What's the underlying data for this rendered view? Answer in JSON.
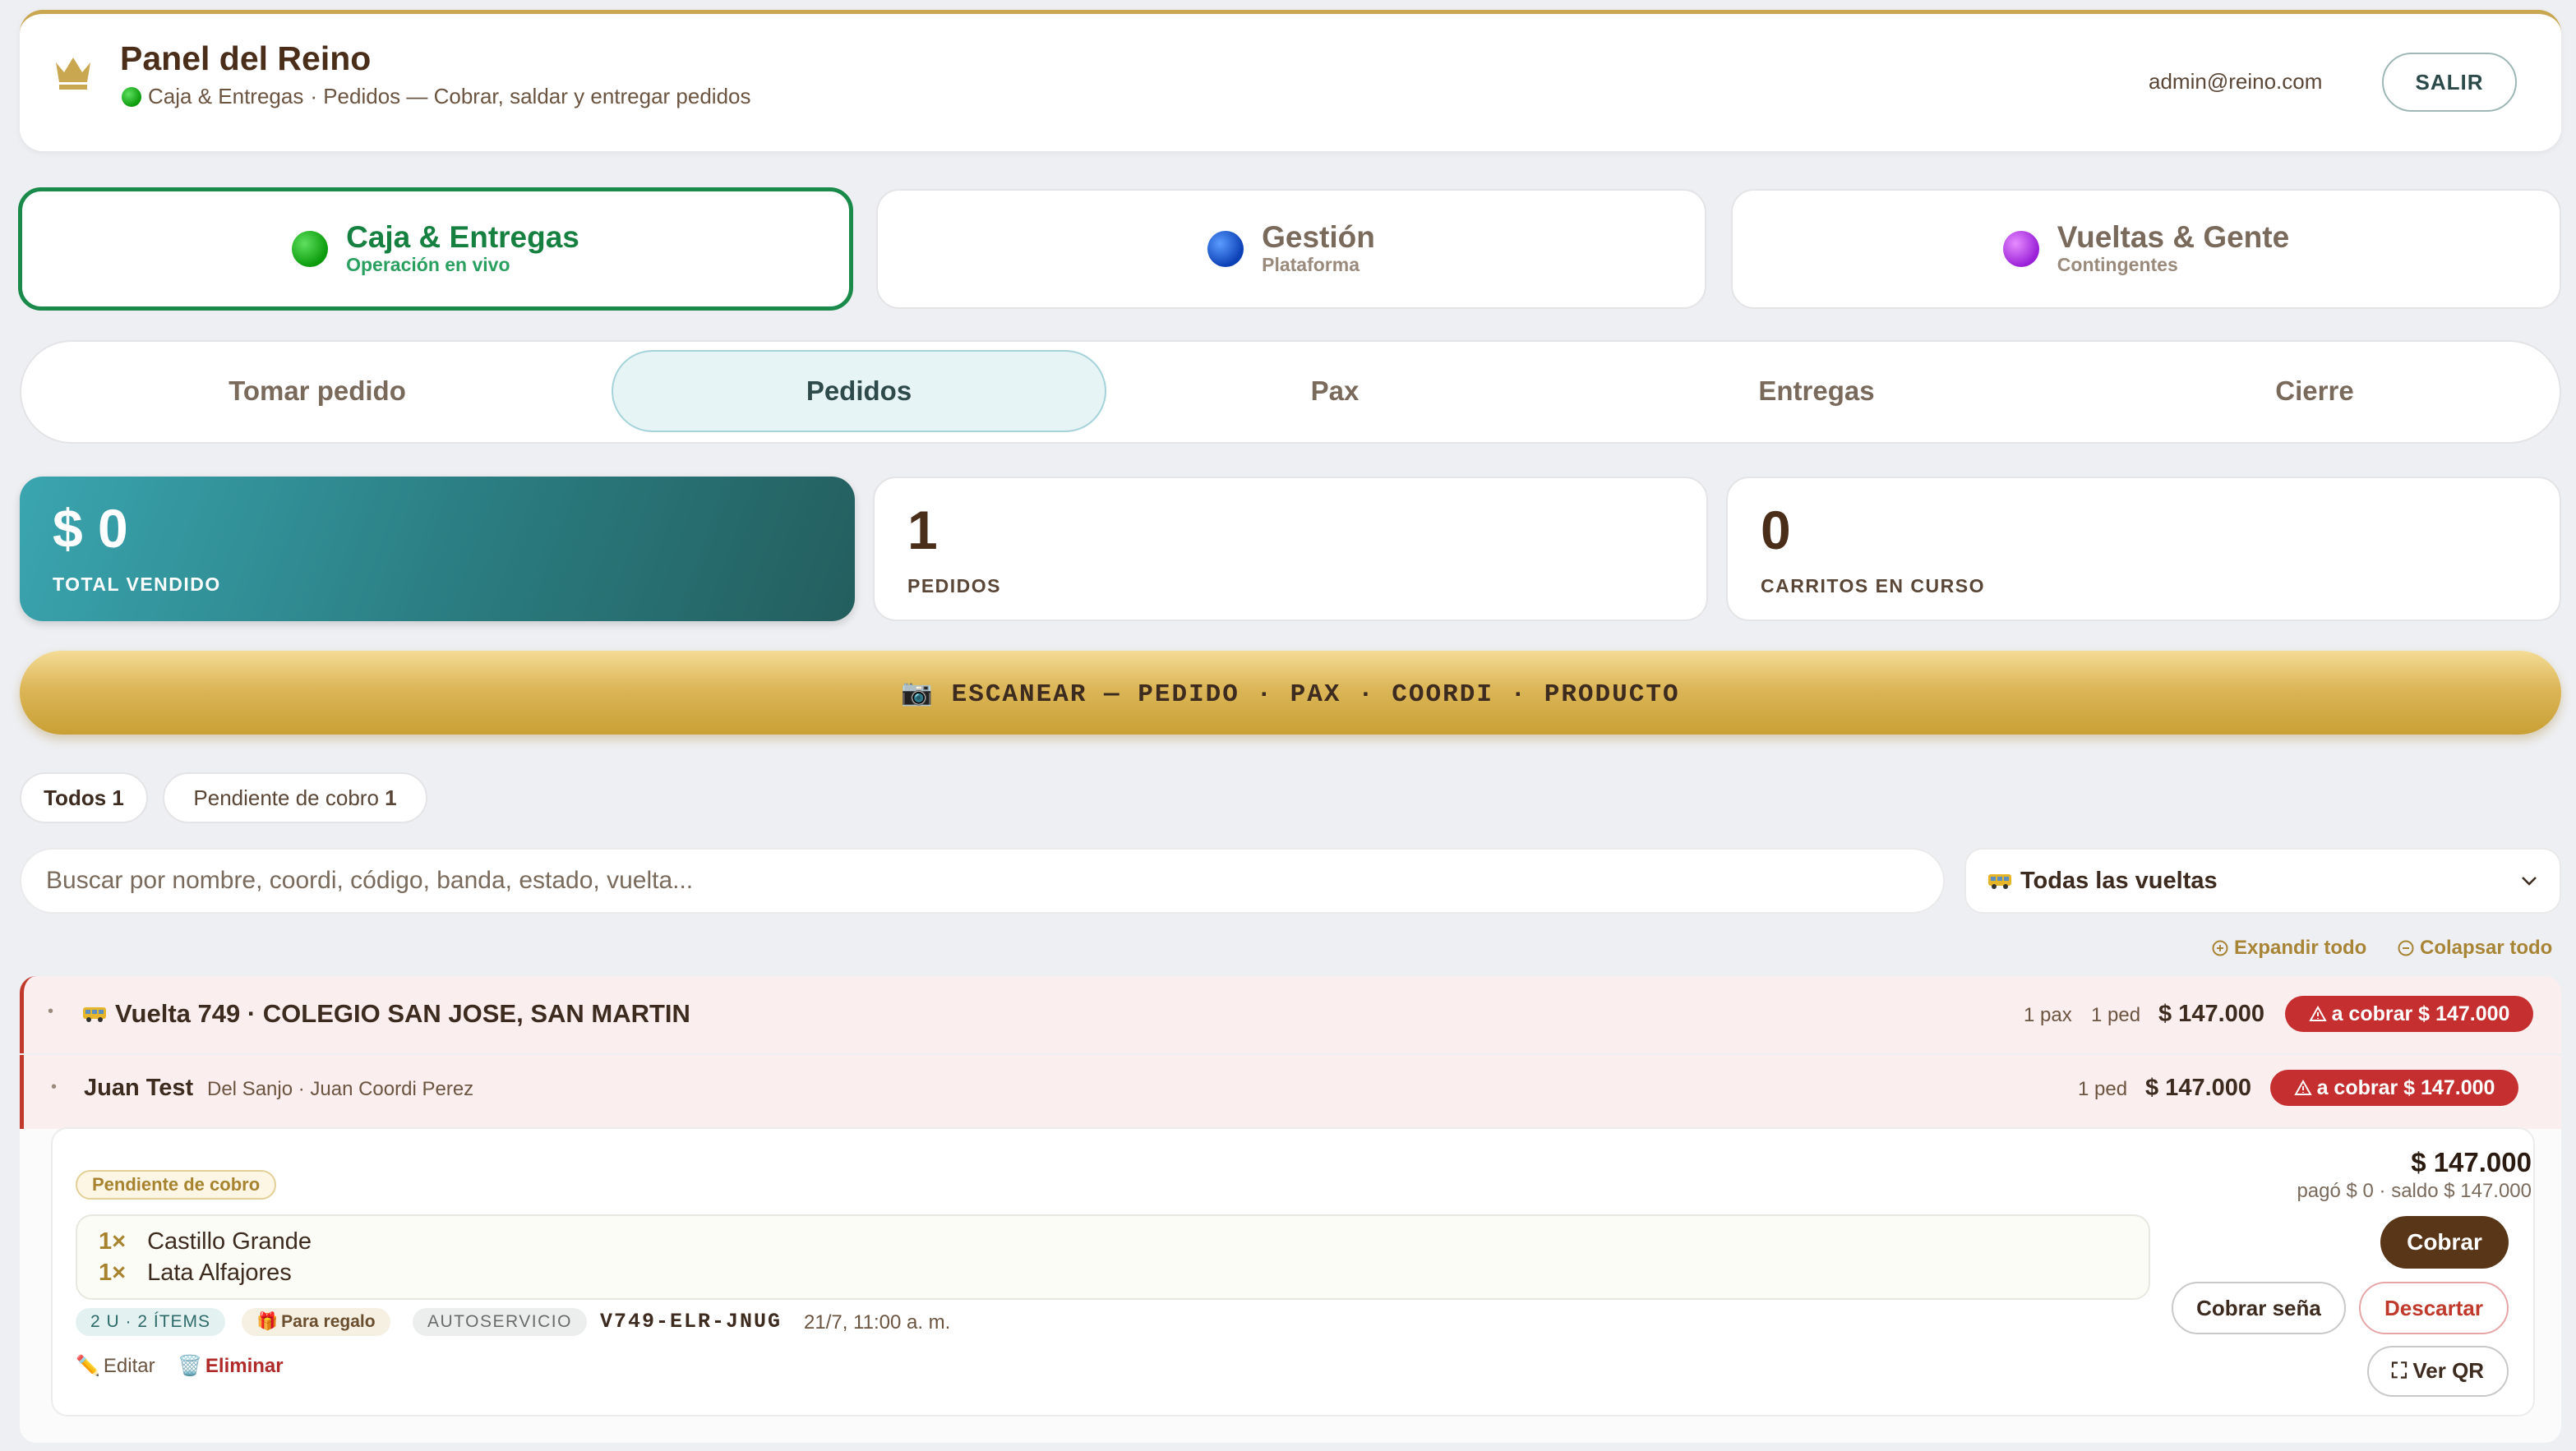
{
  "header": {
    "title": "Panel del Reino",
    "module_name": "Caja & Entregas",
    "subtitle": "· Pedidos — Cobrar, saldar y entregar pedidos",
    "user_email": "admin@reino.com",
    "logout_label": "SALIR"
  },
  "modules": [
    {
      "title": "Caja & Entregas",
      "sub": "Operación en vivo",
      "color": "#0a9a0a",
      "active": true
    },
    {
      "title": "Gestión",
      "sub": "Plataforma",
      "color": "#0b3fb5"
    },
    {
      "title": "Vueltas & Gente",
      "sub": "Contingentes",
      "color": "#9a20d8"
    }
  ],
  "tabs": [
    "Tomar pedido",
    "Pedidos",
    "Pax",
    "Entregas",
    "Cierre"
  ],
  "active_tab": "Pedidos",
  "stats": {
    "total": {
      "value": "$ 0",
      "label": "TOTAL VENDIDO"
    },
    "orders": {
      "value": "1",
      "label": "PEDIDOS"
    },
    "carts": {
      "value": "0",
      "label": "CARRITOS EN CURSO"
    }
  },
  "scan_label": "📷 ESCANEAR — PEDIDO · PAX · COORDI · PRODUCTO",
  "filters": {
    "all_label": "Todos",
    "all_count": "1",
    "pending_label": "Pendiente de cobro",
    "pending_count": "1"
  },
  "search": {
    "placeholder": "Buscar por nombre, coordi, código, banda, estado, vuelta..."
  },
  "trip_select": {
    "value": "Todas las vueltas",
    "icon": "bus-icon"
  },
  "expand_all": "Expandir todo",
  "collapse_all": "Colapsar todo",
  "group": {
    "title": "Vuelta 749 · COLEGIO SAN JOSE, SAN MARTIN",
    "pax": "1 pax",
    "orders": "1 ped",
    "amount": "$ 147.000",
    "due_badge": "a cobrar $ 147.000"
  },
  "person": {
    "name": "Juan Test",
    "meta": "Del Sanjo · Juan Coordi Perez",
    "orders": "1 ped",
    "amount": "$ 147.000",
    "due_badge": "a cobrar $ 147.000"
  },
  "order": {
    "status": "Pendiente de cobro",
    "items": [
      {
        "qty": "1×",
        "name": "Castillo Grande"
      },
      {
        "qty": "1×",
        "name": "Lata Alfajores"
      }
    ],
    "units_tag": "2 U · 2 ÍTEMS",
    "gift_tag": "Para regalo",
    "self_tag": "AUTOSERVICIO",
    "code": "V749-ELR-JNUG",
    "date": "21/7, 11:00 a. m.",
    "edit_label": "Editar",
    "delete_label": "Eliminar",
    "amount": "$ 147.000",
    "paid_info": "pagó $ 0 · saldo $ 147.000",
    "charge_label": "Cobrar",
    "deposit_label": "Cobrar seña",
    "discard_label": "Descartar",
    "qr_label": "Ver QR"
  },
  "colors": {
    "accent_gold": "#c9a650",
    "active_green": "#1a8a4a",
    "danger": "#c62f2f",
    "teal": "#2a7c80",
    "brown": "#5a3618"
  }
}
